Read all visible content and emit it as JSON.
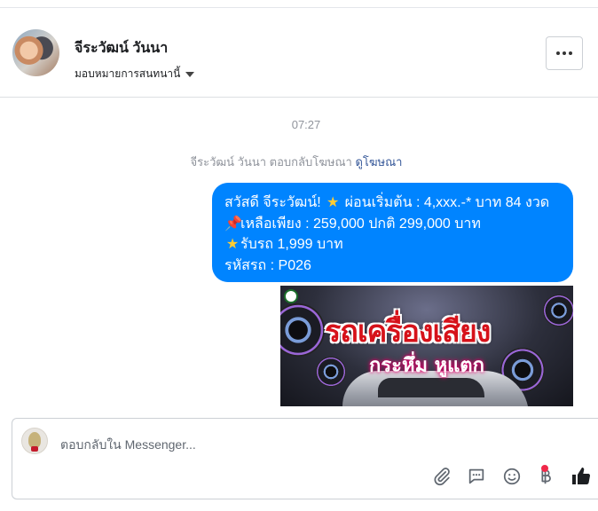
{
  "header": {
    "contact_name": "จีระวัฒน์ วันนา",
    "assign_label": "มอบหมายการสนทนานี้"
  },
  "conversation": {
    "timestamp": "07:27",
    "reply_note_prefix": "จีระวัฒน์ วันนา ตอบกลับโฆษณา",
    "reply_note_link": "ดูโฆษณา",
    "message_lines": [
      {
        "icon": "",
        "text": "สวัสดี จีระวัฒน์! "
      },
      {
        "icon": "pushpin",
        "text": "เหลือเพียง : 259,000 ปกติ 299,000 บาท"
      },
      {
        "icon": "star",
        "text": "รับรถ 1,999 บาท"
      },
      {
        "icon": "",
        "text": "รหัสรถ : P026"
      }
    ],
    "message_line1_tail_icon": "star",
    "message_line1_tail": "ผ่อนเริ่มต้น : 4,xxx.-* บาท 84 งวด",
    "ad_image": {
      "headline": "รถเครื่องเสียง",
      "subheadline": "กระหึ่ม หูแตก"
    }
  },
  "composer": {
    "placeholder": "ตอบกลับใน Messenger...",
    "tools": [
      "paperclip-icon",
      "speech-bubble-icon",
      "smiley-icon",
      "baht-icon",
      "thumbs-up-icon"
    ]
  },
  "colors": {
    "bubble": "#0084ff",
    "link": "#365899",
    "badge": "#f02849"
  }
}
